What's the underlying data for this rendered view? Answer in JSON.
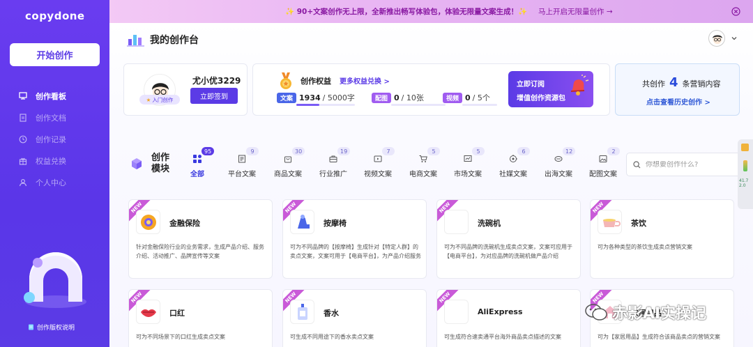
{
  "sidebar": {
    "logo": "copydone",
    "start_button": "开始创作",
    "nav": [
      {
        "label": "创作看板",
        "icon": "dashboard-icon",
        "active": true
      },
      {
        "label": "创作文档",
        "icon": "document-icon",
        "active": false
      },
      {
        "label": "创作记录",
        "icon": "clock-icon",
        "active": false
      },
      {
        "label": "权益兑换",
        "icon": "gift-icon",
        "active": false
      },
      {
        "label": "个人中心",
        "icon": "user-icon",
        "active": false
      }
    ],
    "copyright": "创作版权说明"
  },
  "banner": {
    "text": "✨ 90+文案创作无上限，全新推出畅写体验包，体验无限量文案生成！✨",
    "link": "马上开启无限量创作 →"
  },
  "header": {
    "title": "我的创作台"
  },
  "user_card": {
    "name": "尤小优3229",
    "badge": "入门创作",
    "signin_button": "立即签到"
  },
  "rights": {
    "title": "创作权益",
    "more": "更多权益兑换 >",
    "quotas": [
      {
        "tag": "文案",
        "used": "1934",
        "total": "/ 5000字",
        "ratio": 0.39
      },
      {
        "tag": "配图",
        "used": "0",
        "total": "/ 10张",
        "ratio": 0
      },
      {
        "tag": "视频",
        "used": "0",
        "total": "/ 5个",
        "ratio": 0
      }
    ],
    "promo_line1": "立即订阅",
    "promo_line2": "增值创作资源包"
  },
  "history": {
    "prefix": "共创作",
    "count": "4",
    "suffix": "条营销内容",
    "link": "点击查看历史创作 >"
  },
  "modules": {
    "title": "创作模块",
    "tabs": [
      {
        "label": "全部",
        "count": "95",
        "icon": "grid-icon",
        "active": true
      },
      {
        "label": "平台文案",
        "count": "9",
        "icon": "doc-icon",
        "active": false
      },
      {
        "label": "商品文案",
        "count": "30",
        "icon": "bag-icon",
        "active": false
      },
      {
        "label": "行业推广",
        "count": "19",
        "icon": "briefcase-icon",
        "active": false
      },
      {
        "label": "视频文案",
        "count": "7",
        "icon": "video-icon",
        "active": false
      },
      {
        "label": "电商文案",
        "count": "5",
        "icon": "cart-icon",
        "active": false
      },
      {
        "label": "市场文案",
        "count": "5",
        "icon": "chart-icon",
        "active": false
      },
      {
        "label": "社媒文案",
        "count": "6",
        "icon": "social-icon",
        "active": false
      },
      {
        "label": "出海文案",
        "count": "12",
        "icon": "globe-icon",
        "active": false
      },
      {
        "label": "配图文案",
        "count": "2",
        "icon": "image-icon",
        "active": false
      }
    ],
    "search_placeholder": "你想要创作什么?"
  },
  "cards": [
    {
      "badge": "NEW",
      "name": "金融保险",
      "desc": "针对金融保险行业的业务需求，生成产品介绍、服务介绍、活动推广、品牌宣传等文案",
      "icon": "finance-icon"
    },
    {
      "badge": "NEW",
      "name": "按摩椅",
      "desc": "可为不同品牌的【按摩椅】生成针对【特定人群】的卖点文案，文案可用于【电商平台】，为产品介绍服务",
      "icon": "massage-chair-icon"
    },
    {
      "badge": "NEW",
      "name": "洗碗机",
      "desc": "可为不同品牌的洗碗机生成卖点文案，文案可应用于【电商平台】，为对应品牌的洗碗机做产品介绍",
      "icon": "dishwasher-icon"
    },
    {
      "badge": "NEW",
      "name": "茶饮",
      "desc": "可为各种类型的茶饮生成卖点营销文案",
      "icon": "tea-icon"
    },
    {
      "badge": "NEW",
      "name": "口红",
      "desc": "可为不同场景下的口红生成卖点文案",
      "icon": "lipstick-icon"
    },
    {
      "badge": "NEW",
      "name": "香水",
      "desc": "可生成不同用途下的香水卖点文案",
      "icon": "perfume-icon"
    },
    {
      "badge": "NEW",
      "name": "AliExpress",
      "desc": "可生成符合速卖通平台海外商品卖点描述的文案",
      "icon": "aliexpress-icon"
    },
    {
      "badge": "NEW",
      "name": "家居用品",
      "desc": "可为【家居用品】生成符合该商品卖点的营销文案",
      "icon": "home-goods-icon"
    }
  ],
  "watermark": "赤影AI实操记",
  "colors": {
    "primary": "#5b3be6",
    "banner": "#e9b6f3",
    "accent_blue": "#2a4bdb"
  }
}
